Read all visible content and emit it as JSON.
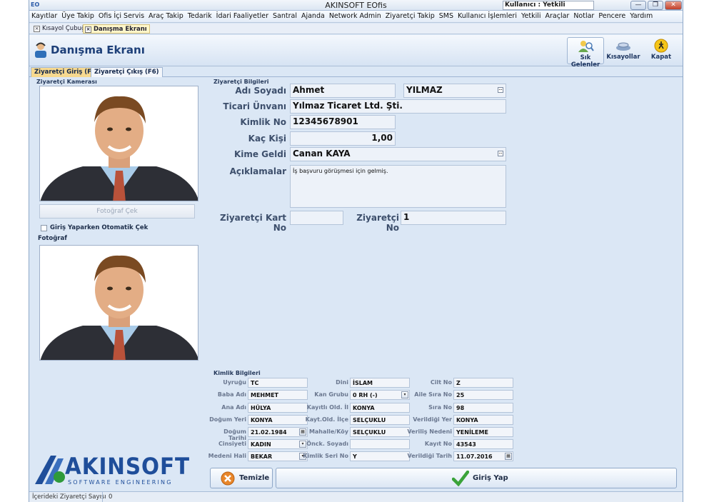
{
  "window": {
    "title": "AKINSOFT EOfis",
    "user_label": "Kullanıcı : Yetkili",
    "app_icon_text": "EO",
    "min_glyph": "—",
    "restore_glyph": "❐",
    "close_glyph": "✕"
  },
  "menu": [
    "Kayıtlar",
    "Üye Takip",
    "Ofis İçi Servis",
    "Araç Takip",
    "Tedarik",
    "İdari Faaliyetler",
    "Santral",
    "Ajanda",
    "Network Admin",
    "Ziyaretçi Takip",
    "SMS",
    "Kullanıcı İşlemleri",
    "Yetkili",
    "Araçlar",
    "Notlar",
    "Pencere",
    "Yardım"
  ],
  "doc_tabs": [
    "Kısayol Çubuğu",
    "Danışma Ekranı"
  ],
  "header": {
    "title": "Danışma Ekranı",
    "buttons": [
      "Sık Gelenler",
      "Kısayollar",
      "Kapat"
    ]
  },
  "page_tabs": [
    "Ziyaretçi Giriş (F5)",
    "Ziyaretçi Çıkış (F6)"
  ],
  "camera": {
    "group_title": "Ziyaretçi Kamerası",
    "capture_button": "Fotoğraf Çek",
    "auto_capture_label": "Giriş Yaparken Otomatik Çek",
    "auto_capture_checked": false,
    "photo_title": "Fotoğraf"
  },
  "visitor": {
    "group_title": "Ziyaretçi Bilgileri",
    "name_label": "Adı Soyadı",
    "first_name": "Ahmet",
    "last_name": "YILMAZ",
    "company_label": "Ticari Ünvanı",
    "company": "Yılmaz Ticaret Ltd. Şti.",
    "id_label": "Kimlik No",
    "id_no": "12345678901",
    "count_label": "Kaç Kişi",
    "count": "1,00",
    "host_label": "Kime Geldi",
    "host": "Canan KAYA",
    "notes_label": "Açıklamalar",
    "notes": "İş başvuru görüşmesi için gelmiş.",
    "card_label": "Ziyaretçi Kart No",
    "card_no": "",
    "visitor_no_label": "Ziyaretçi No",
    "visitor_no": "1"
  },
  "identity": {
    "group_title": "Kimlik Bilgileri",
    "col1": [
      {
        "label": "Uyruğu",
        "value": "TC"
      },
      {
        "label": "Baba Adı",
        "value": "MEHMET"
      },
      {
        "label": "Ana Adı",
        "value": "HÜLYA"
      },
      {
        "label": "Doğum Yeri",
        "value": "KONYA"
      },
      {
        "label": "Doğum Tarihi",
        "value": "21.02.1984"
      },
      {
        "label": "Cinsiyeti",
        "value": "KADIN"
      },
      {
        "label": "Medeni Hali",
        "value": "BEKAR"
      }
    ],
    "col2": [
      {
        "label": "Dini",
        "value": "İSLAM"
      },
      {
        "label": "Kan Grubu",
        "value": "0 RH (-)"
      },
      {
        "label": "Kayıtlı Old. İl",
        "value": "KONYA"
      },
      {
        "label": "Kayt.Old. İlçe",
        "value": "SELÇUKLU"
      },
      {
        "label": "Mahalle/Köy",
        "value": "SELÇUKLU"
      },
      {
        "label": "Önck. Soyadı",
        "value": ""
      },
      {
        "label": "Kimlik Seri No",
        "value": "Y"
      }
    ],
    "col3": [
      {
        "label": "Cilt No",
        "value": "Z"
      },
      {
        "label": "Aile Sıra No",
        "value": "25"
      },
      {
        "label": "Sıra No",
        "value": "98"
      },
      {
        "label": "Verildiği Yer",
        "value": "KONYA"
      },
      {
        "label": "Veriliş Nedeni",
        "value": "YENİLEME"
      },
      {
        "label": "Kayıt No",
        "value": "43543"
      },
      {
        "label": "Verildiği Tarih",
        "value": "11.07.2016"
      }
    ]
  },
  "actions": {
    "clear": "Temizle",
    "submit": "Giriş Yap"
  },
  "logo": {
    "brand": "AKINSOFT",
    "tagline": "SOFTWARE ENGINEERING"
  },
  "status": {
    "label": "İçerideki Ziyaretçi Sayısı",
    "value": "0"
  }
}
